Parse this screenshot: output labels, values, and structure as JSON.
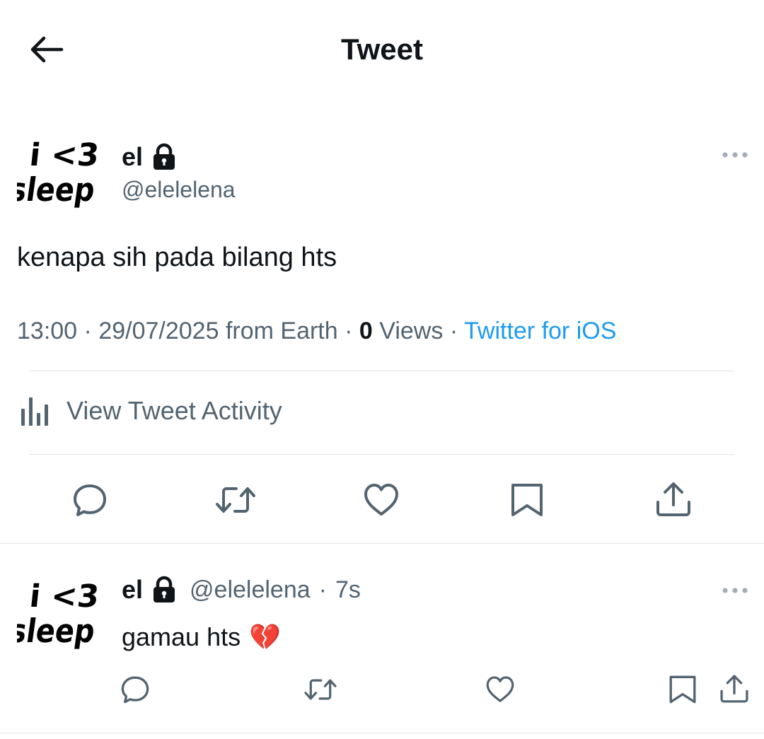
{
  "header": {
    "title": "Tweet",
    "back_icon": "arrow-left-icon"
  },
  "avatar_text": {
    "line1": "i <3",
    "line2": "sleep"
  },
  "main_tweet": {
    "name": "el",
    "handle": "@elelelena",
    "text": "kenapa sih pada bilang hts",
    "time": "13:00",
    "date": "29/07/2025",
    "location": "from Earth",
    "view_count": "0",
    "views_label": "Views",
    "client": "Twitter for iOS",
    "activity_label": "View Tweet Activity"
  },
  "reply": {
    "name": "el",
    "handle": "@elelelena",
    "time": "7s",
    "text": "gamau hts",
    "emoji": "💔"
  },
  "colors": {
    "link": "#1d9bf0",
    "secondary": "#536471",
    "primary": "#0f1419",
    "divider": "#e1e6ea"
  }
}
